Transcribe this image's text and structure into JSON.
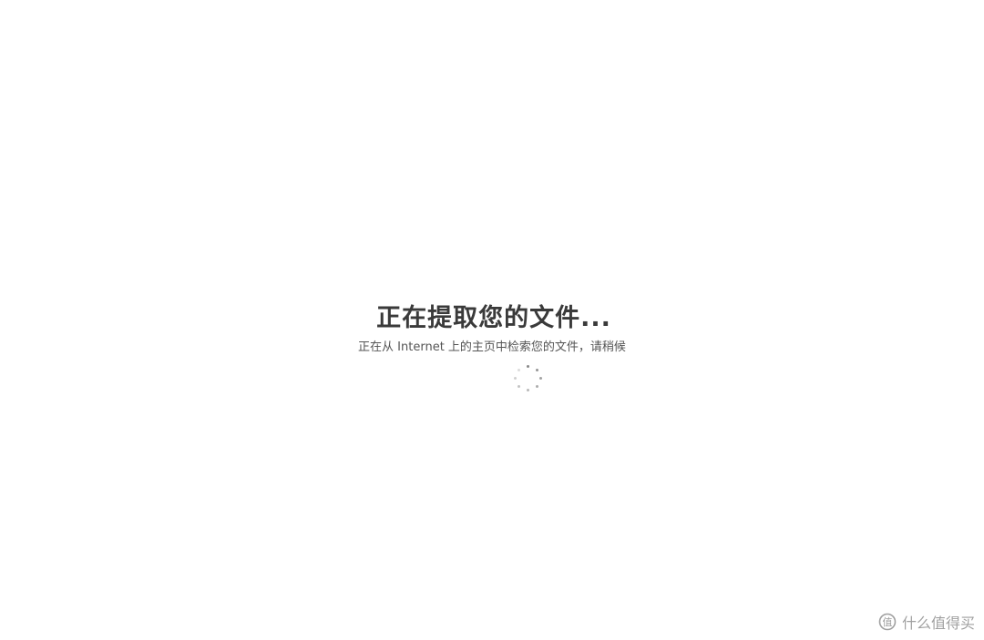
{
  "loading": {
    "title": "正在提取您的文件...",
    "subtitle": "正在从 Internet 上的主页中检索您的文件，请稍候"
  },
  "spinner": {
    "icon": "loading-dots-spinner"
  },
  "watermark": {
    "text": "什么值得买"
  },
  "colors": {
    "background": "#ffffff",
    "title": "#3a3a3a",
    "subtitle": "#555555",
    "spinner": "#8a8a8a",
    "watermark": "#a0a0a0"
  }
}
